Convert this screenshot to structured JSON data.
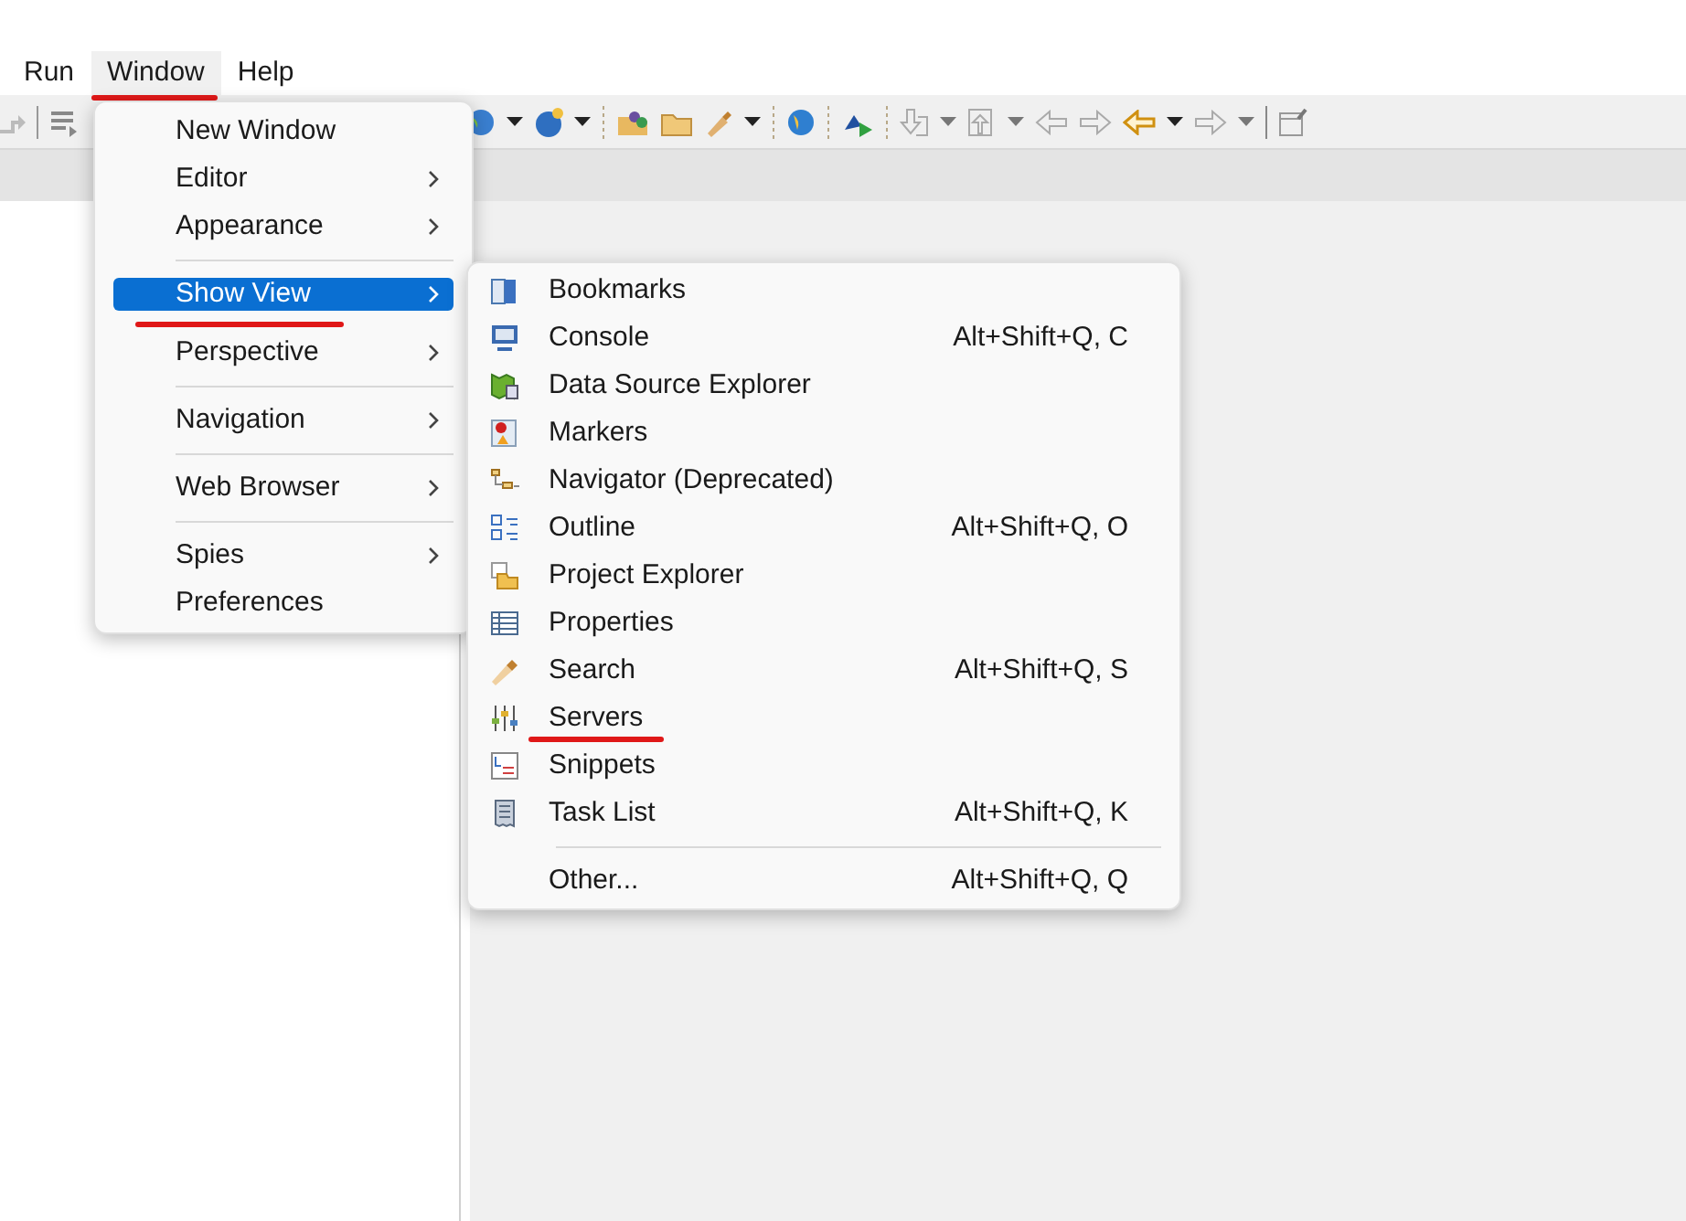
{
  "menubar": [
    {
      "label": "Run",
      "open": false,
      "underlined": false
    },
    {
      "label": "Window",
      "open": true,
      "underlined": true
    },
    {
      "label": "Help",
      "open": false,
      "underlined": false
    }
  ],
  "window_menu": [
    {
      "label": "New Window",
      "submenu": false,
      "selected": false,
      "underlined": false,
      "separator_before": false
    },
    {
      "label": "Editor",
      "submenu": true,
      "selected": false,
      "underlined": false,
      "separator_before": false
    },
    {
      "label": "Appearance",
      "submenu": true,
      "selected": false,
      "underlined": false,
      "separator_before": false
    },
    {
      "label": "Show View",
      "submenu": true,
      "selected": true,
      "underlined": true,
      "separator_before": true
    },
    {
      "label": "Perspective",
      "submenu": true,
      "selected": false,
      "underlined": false,
      "separator_before": false
    },
    {
      "label": "Navigation",
      "submenu": true,
      "selected": false,
      "underlined": false,
      "separator_before": true
    },
    {
      "label": "Web Browser",
      "submenu": true,
      "selected": false,
      "underlined": false,
      "separator_before": true
    },
    {
      "label": "Spies",
      "submenu": true,
      "selected": false,
      "underlined": false,
      "separator_before": true
    },
    {
      "label": "Preferences",
      "submenu": false,
      "selected": false,
      "underlined": false,
      "separator_before": false
    }
  ],
  "show_view_menu": [
    {
      "label": "Bookmarks",
      "underlined": false,
      "separator_before": false
    },
    {
      "label": "Console",
      "shortcut": "Alt+Shift+Q, C",
      "underlined": false,
      "separator_before": false
    },
    {
      "label": "Data Source Explorer",
      "underlined": false,
      "separator_before": false
    },
    {
      "label": "Markers",
      "underlined": false,
      "separator_before": false
    },
    {
      "label": "Navigator (Deprecated)",
      "underlined": false,
      "separator_before": false
    },
    {
      "label": "Outline",
      "shortcut": "Alt+Shift+Q, O",
      "underlined": false,
      "separator_before": false
    },
    {
      "label": "Project Explorer",
      "underlined": false,
      "separator_before": false
    },
    {
      "label": "Properties",
      "underlined": false,
      "separator_before": false
    },
    {
      "label": "Search",
      "shortcut": "Alt+Shift+Q, S",
      "underlined": false,
      "separator_before": false
    },
    {
      "label": "Servers",
      "underlined": true,
      "separator_before": false
    },
    {
      "label": "Snippets",
      "underlined": false,
      "separator_before": false
    },
    {
      "label": "Task List",
      "shortcut": "Alt+Shift+Q, K",
      "underlined": false,
      "separator_before": false
    },
    {
      "label": "Other...",
      "shortcut": "Alt+Shift+Q, Q",
      "underlined": false,
      "separator_before": true
    }
  ]
}
